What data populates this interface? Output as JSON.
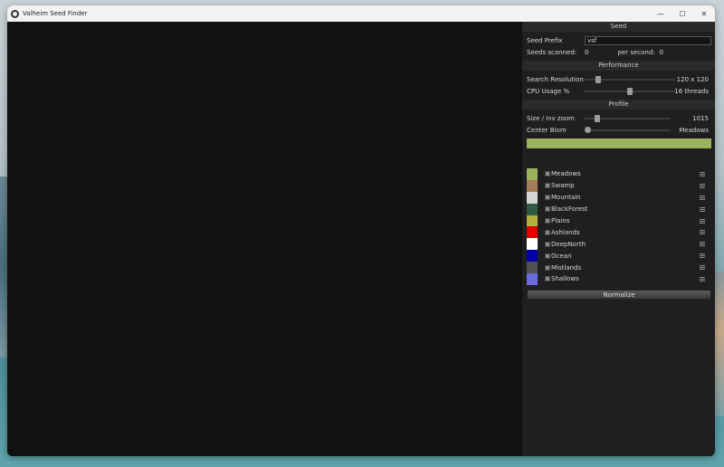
{
  "window": {
    "title": "Valheim Seed Finder",
    "controls": {
      "minimize": "—",
      "maximize": "☐",
      "close": "✕"
    }
  },
  "seed": {
    "header": "Seed",
    "prefix_label": "Seed Prefix",
    "prefix_value": "vsf",
    "scanned_label": "Seeds scanned:",
    "scanned_value": "0",
    "per_second_label": "per second:",
    "per_second_value": "0"
  },
  "performance": {
    "header": "Performance",
    "resolution_label": "Search Resolution",
    "resolution_value": "120 x 120",
    "resolution_level": 0.13,
    "cpu_label": "CPU Usage %",
    "cpu_value": "16 threads",
    "cpu_level": 0.5
  },
  "profile": {
    "header": "Profile",
    "size_label": "Size / inv zoom",
    "size_value": "1015",
    "size_level": 0.12,
    "biome_label": "Center Biom",
    "biome_value": "Meadows",
    "biome_level": 0.0,
    "bar_color": "#9cb35e",
    "biomes": [
      {
        "name": "Meadows",
        "color": "#9cb35e"
      },
      {
        "name": "Swamp",
        "color": "#a27d5c"
      },
      {
        "name": "Mountain",
        "color": "#d5d5d5"
      },
      {
        "name": "BlackForest",
        "color": "#2f5a45"
      },
      {
        "name": "Plains",
        "color": "#b2b03e"
      },
      {
        "name": "Ashlands",
        "color": "#e00000"
      },
      {
        "name": "DeepNorth",
        "color": "#ffffff"
      },
      {
        "name": "Ocean",
        "color": "#0000a6"
      },
      {
        "name": "Mistlands",
        "color": "#505050"
      },
      {
        "name": "Shallows",
        "color": "#6b6be0"
      }
    ],
    "normalize_label": "Normalize"
  }
}
